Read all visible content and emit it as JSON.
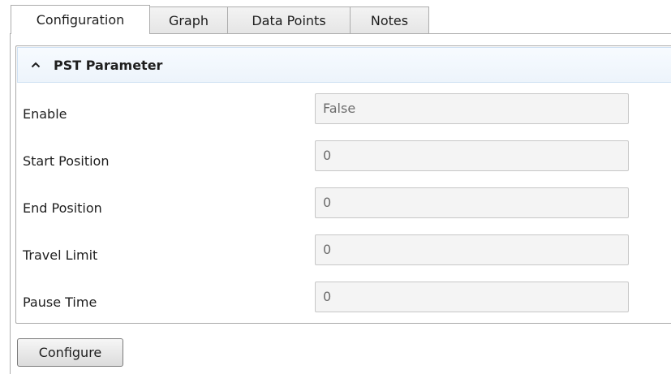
{
  "tabs": [
    {
      "label": "Configuration",
      "active": true
    },
    {
      "label": "Graph",
      "active": false
    },
    {
      "label": "Data Points",
      "active": false
    },
    {
      "label": "Notes",
      "active": false
    }
  ],
  "group": {
    "title": "PST Parameter",
    "expanded": true,
    "chevron_icon": "chevron-up-icon",
    "header_color": "#eef5fc"
  },
  "parameters": [
    {
      "label": "Enable",
      "value": "False"
    },
    {
      "label": "Start Position",
      "value": "0"
    },
    {
      "label": "End Position",
      "value": "0"
    },
    {
      "label": "Travel Limit",
      "value": "0"
    },
    {
      "label": "Pause Time",
      "value": "0"
    }
  ],
  "actions": {
    "configure_label": "Configure"
  }
}
